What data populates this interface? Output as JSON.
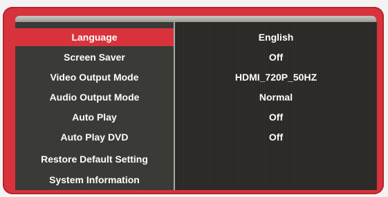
{
  "settings_menu": {
    "items": [
      {
        "label": "Language",
        "value": "English",
        "selected": true
      },
      {
        "label": "Screen Saver",
        "value": "Off"
      },
      {
        "label": "Video Output Mode",
        "value": "HDMI_720P_50HZ"
      },
      {
        "label": "Audio Output Mode",
        "value": "Normal"
      },
      {
        "label": "Auto Play",
        "value": "Off"
      },
      {
        "label": "Auto Play DVD",
        "value": "Off"
      },
      {
        "label": "Restore Default Setting",
        "value": ""
      },
      {
        "label": "System Information",
        "value": ""
      }
    ]
  },
  "colors": {
    "accent": "#d8333d",
    "panel": "#3a3b36",
    "background": "#2a2926"
  }
}
